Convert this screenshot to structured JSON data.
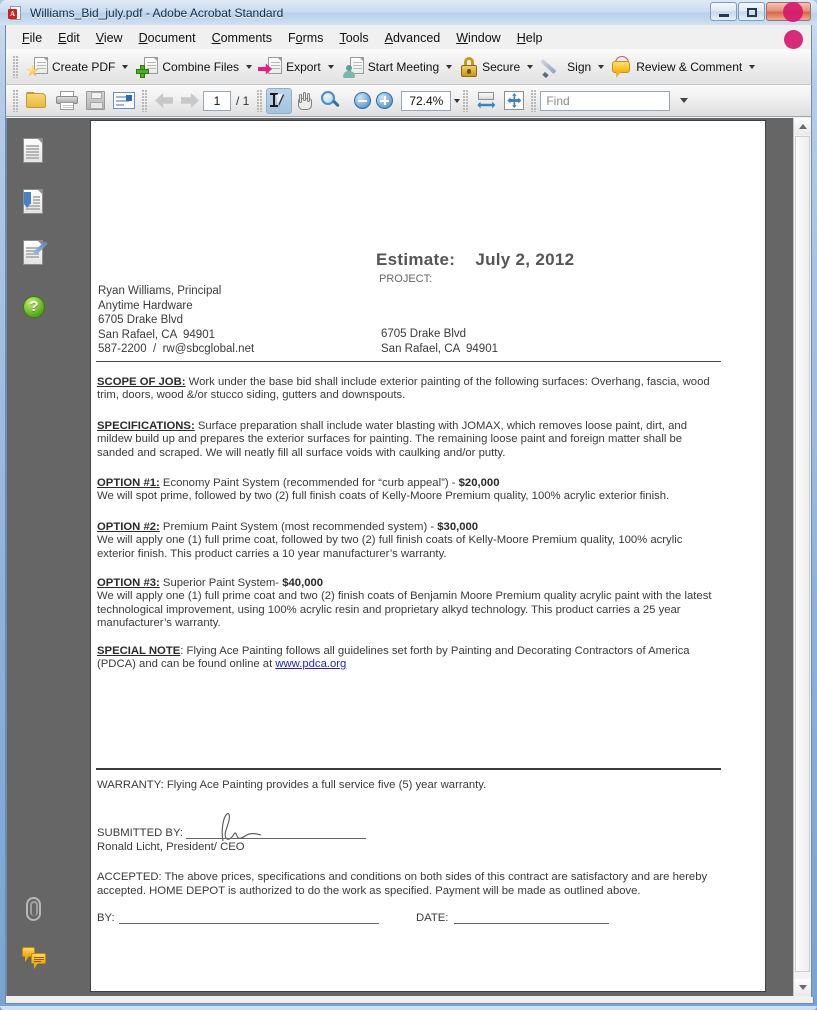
{
  "window": {
    "title": "Williams_Bid_july.pdf - Adobe Acrobat Standard",
    "app_icon": "pdf-file-icon",
    "buttons": {
      "minimize": "minimize-button",
      "maximize": "maximize-button",
      "close": "close-button"
    }
  },
  "menubar": {
    "items": [
      {
        "label": "File",
        "mnemonic": "F"
      },
      {
        "label": "Edit",
        "mnemonic": "E"
      },
      {
        "label": "View",
        "mnemonic": "V"
      },
      {
        "label": "Document",
        "mnemonic": "D"
      },
      {
        "label": "Comments",
        "mnemonic": "C"
      },
      {
        "label": "Forms",
        "mnemonic": "o"
      },
      {
        "label": "Tools",
        "mnemonic": "T"
      },
      {
        "label": "Advanced",
        "mnemonic": "A"
      },
      {
        "label": "Window",
        "mnemonic": "W"
      },
      {
        "label": "Help",
        "mnemonic": "H"
      }
    ]
  },
  "toolbar_tasks": {
    "items": [
      {
        "label": "Create PDF",
        "icon": "create-pdf-icon",
        "has_dropdown": true
      },
      {
        "label": "Combine Files",
        "icon": "combine-files-icon",
        "has_dropdown": true
      },
      {
        "label": "Export",
        "icon": "export-icon",
        "has_dropdown": true
      },
      {
        "label": "Start Meeting",
        "icon": "start-meeting-icon",
        "has_dropdown": true
      },
      {
        "label": "Secure",
        "icon": "lock-icon",
        "has_dropdown": true
      },
      {
        "label": "Sign",
        "icon": "pen-icon",
        "has_dropdown": true
      },
      {
        "label": "Review & Comment",
        "icon": "comment-bubble-icon",
        "has_dropdown": true
      }
    ]
  },
  "toolbar_file": {
    "open_icon": "folder-open-icon",
    "print_icon": "printer-icon",
    "save_icon": "save-floppy-icon",
    "email_icon": "email-icon",
    "prev_page_icon": "arrow-left-icon",
    "next_page_icon": "arrow-right-icon",
    "page_value": "1",
    "page_total": "/ 1",
    "select_tool_icon": "select-text-icon",
    "hand_tool_icon": "hand-icon",
    "marquee_zoom_icon": "marquee-zoom-icon",
    "zoom_out_icon": "zoom-out-icon",
    "zoom_in_icon": "zoom-in-icon",
    "zoom_value": "72.4%",
    "fit_width_icon": "fit-width-icon",
    "fit_page_icon": "fit-page-icon",
    "find_placeholder": "Find",
    "find_value": ""
  },
  "navpane": {
    "items": [
      {
        "icon": "pages-panel-icon",
        "name": "pages"
      },
      {
        "icon": "bookmarks-panel-icon",
        "name": "bookmarks"
      },
      {
        "icon": "signatures-panel-icon",
        "name": "signatures"
      },
      {
        "icon": "help-panel-icon",
        "name": "how-to"
      },
      {
        "icon": "attachments-panel-icon",
        "name": "attachments"
      },
      {
        "icon": "comments-panel-icon",
        "name": "comments"
      }
    ]
  },
  "document": {
    "estimate_heading": "Estimate:    July 2, 2012",
    "project_label": "PROJECT:",
    "client_block": "Ryan Williams, Principal\nAnytime Hardware\n6705 Drake Blvd\nSan Rafael, CA  94901\n587-2200  /  rw@sbcglobal.net",
    "project_block": "6705 Drake Blvd\nSan Rafael, CA  94901",
    "sections": [
      {
        "id": "scope",
        "heading": "SCOPE OF JOB:",
        "body": " Work under the base bid shall include exterior painting of the following surfaces: Overhang, fascia, wood trim, doors, wood &/or stucco siding, gutters and downspouts."
      },
      {
        "id": "specifications",
        "heading": "SPECIFICATIONS:",
        "body": " Surface preparation shall include water blasting with JOMAX, which removes loose paint, dirt, and mildew build up and prepares the exterior surfaces for painting.  The remaining loose paint and foreign matter shall be sanded and scraped. We will neatly fill all surface voids with caulking and/or putty."
      },
      {
        "id": "option-1",
        "heading": "OPTION #1:",
        "lead": " Economy Paint System (recommended for “curb appeal”) - ",
        "amount": "$20,000",
        "body": "We will spot prime, followed by two (2) full finish coats of Kelly-Moore Premium quality, 100% acrylic exterior finish."
      },
      {
        "id": "option-2",
        "heading": "OPTION #2:",
        "lead": " Premium Paint System (most recommended system) - ",
        "amount": "$30,000",
        "body": "We will apply one (1) full prime coat, followed by two (2) full finish coats of Kelly-Moore Premium quality, 100% acrylic exterior finish.  This product carries a 10 year manufacturer’s warranty."
      },
      {
        "id": "option-3",
        "heading": "OPTION #3:",
        "lead": "  Superior Paint System- ",
        "amount": "$40,000",
        "body": "We will apply one (1) full prime coat and two (2) finish coats of Benjamin Moore Premium quality acrylic paint with the latest technological improvement, using 100% acrylic resin and proprietary alkyd technology.  This product carries a 25 year manufacturer’s warranty."
      },
      {
        "id": "special-note",
        "heading": "SPECIAL NOTE",
        "lead": ":  Flying Ace Painting follows all guidelines set forth by Painting and Decorating Contractors of America (PDCA) and can be found online at ",
        "link": "www.pdca.org"
      }
    ],
    "warranty": "WARRANTY: Flying Ace Painting provides a full service five (5) year warranty.",
    "submitted_by_label": "SUBMITTED BY:",
    "submitted_by_name": "Ronald Licht, President/ CEO",
    "accepted_text": "ACCEPTED:  The above prices, specifications and conditions on both sides of this contract are satisfactory and are hereby accepted.  HOME DEPOT is authorized to do the work as specified.  Payment will be made as outlined above.",
    "by_label": "BY:",
    "date_label": "DATE:"
  },
  "scrollbar": {
    "up_icon": "scroll-up-arrow-icon",
    "down_icon": "scroll-down-arrow-icon"
  },
  "colors": {
    "accent": "#d6196f",
    "window_chrome": "#8fb2d8",
    "workspace": "#666666",
    "link": "#2222cc"
  }
}
